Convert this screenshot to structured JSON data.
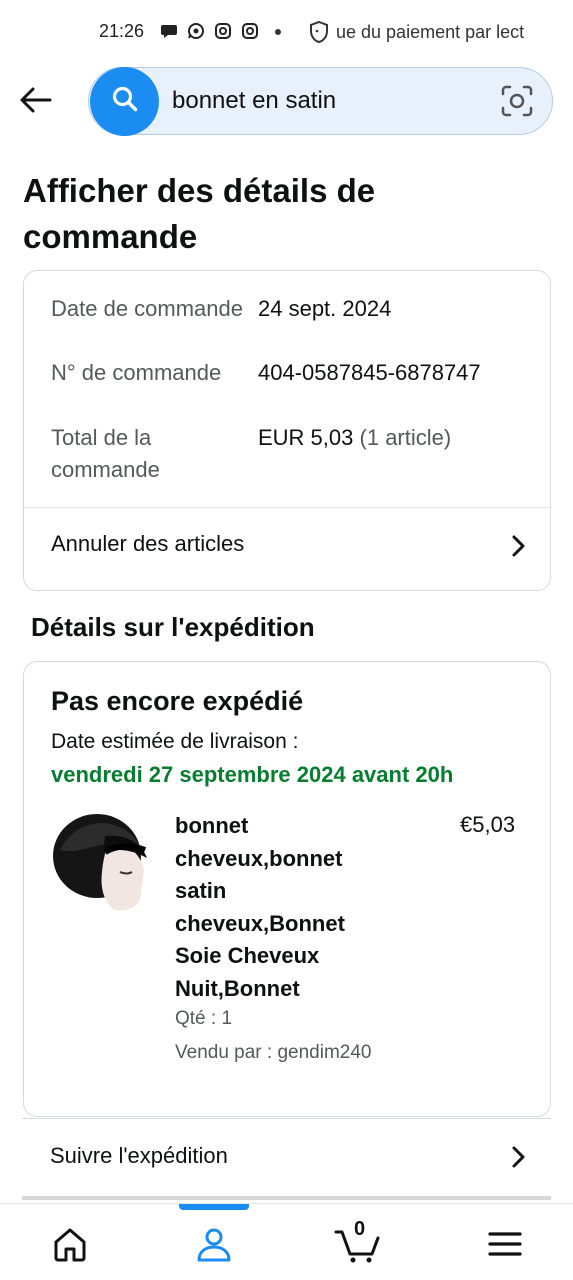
{
  "status_bar": {
    "time": "21:26",
    "notification": "ue du paiement par lect",
    "icons": [
      "chat-bubble-icon",
      "whatsapp-icon",
      "instagram-icon",
      "instagram-icon",
      "dot-icon",
      "shield-icon"
    ]
  },
  "search": {
    "query": "bonnet en satin"
  },
  "page": {
    "title": "Afficher des détails de commande"
  },
  "order_summary": {
    "rows": [
      {
        "label": "Date de commande",
        "value": "24 sept. 2024"
      },
      {
        "label": "N° de commande",
        "value": "404-0587845-6878747"
      },
      {
        "label": "Total de la commande",
        "value": "EUR 5,03",
        "value_extra": "(1 article)"
      }
    ],
    "cancel_label": "Annuler des articles"
  },
  "shipment": {
    "section_title": "Détails sur l'expédition",
    "status": "Pas encore expédié",
    "estimate_label": "Date estimée de livraison :",
    "estimate_date": "vendredi 27 septembre 2024 avant 20h",
    "estimate_color": "#067d2e",
    "product": {
      "name": "bonnet cheveux,bonnet satin cheveux,Bonnet Soie Cheveux Nuit,Bonnet",
      "price": "€5,03",
      "qty": "Qté : 1",
      "seller": "Vendu par : gendim240"
    },
    "track_label": "Suivre l'expédition"
  },
  "bottom_nav": {
    "items": [
      "home-icon",
      "account-icon",
      "cart-icon",
      "menu-icon"
    ],
    "active": "account-icon",
    "cart_count": "0",
    "accent": "#1a8cf2"
  }
}
